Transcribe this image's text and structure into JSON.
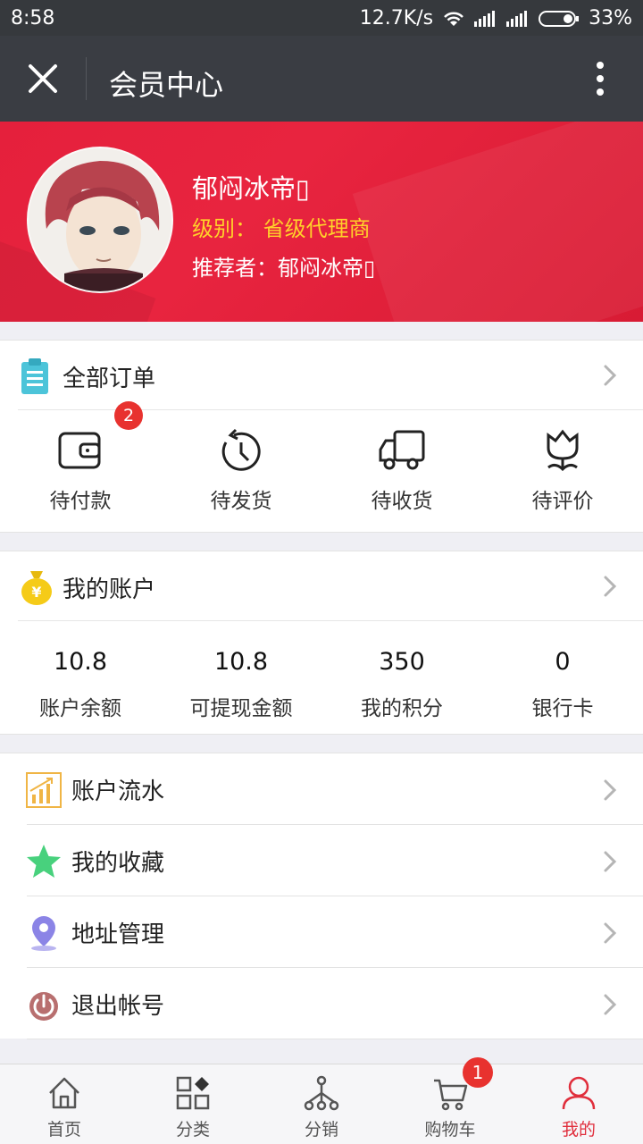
{
  "status_bar": {
    "time": "8:58",
    "speed": "12.7K/s",
    "battery": "33%"
  },
  "header": {
    "title": "会员中心"
  },
  "profile": {
    "name": "郁闷冰帝▯",
    "level": "级别：  省级代理商",
    "referrer": "推荐者：郁闷冰帝▯"
  },
  "orders": {
    "title": "全部订单",
    "items": [
      {
        "label": "待付款",
        "icon": "wallet-icon",
        "badge": "2"
      },
      {
        "label": "待发货",
        "icon": "clock-icon"
      },
      {
        "label": "待收货",
        "icon": "truck-icon"
      },
      {
        "label": "待评价",
        "icon": "flower-icon"
      }
    ]
  },
  "account": {
    "title": "我的账户",
    "items": [
      {
        "value": "10.8",
        "label": "账户余额"
      },
      {
        "value": "10.8",
        "label": "可提现金额"
      },
      {
        "value": "350",
        "label": "我的积分"
      },
      {
        "value": "0",
        "label": "银行卡"
      }
    ]
  },
  "menu": [
    {
      "label": "账户流水",
      "icon": "chart-icon"
    },
    {
      "label": "我的收藏",
      "icon": "star-icon"
    },
    {
      "label": "地址管理",
      "icon": "location-pin-icon"
    },
    {
      "label": "退出帐号",
      "icon": "power-icon"
    }
  ],
  "tabbar": [
    {
      "label": "首页",
      "icon": "home-icon"
    },
    {
      "label": "分类",
      "icon": "category-icon"
    },
    {
      "label": "分销",
      "icon": "distribution-icon"
    },
    {
      "label": "购物车",
      "icon": "cart-icon",
      "badge": "1"
    },
    {
      "label": "我的",
      "icon": "user-icon",
      "active": true
    }
  ],
  "colors": {
    "accent": "#e02e3c",
    "header_bg": "#3a3d43",
    "level_text": "#ffd12a"
  }
}
